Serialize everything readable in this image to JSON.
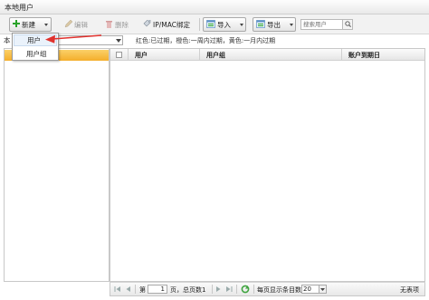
{
  "window": {
    "title": "本地用户"
  },
  "toolbar": {
    "new_label": "新建",
    "edit_label": "编辑",
    "delete_label": "删除",
    "ipmac_label": "IP/MAC绑定",
    "import_label": "导入",
    "export_label": "导出",
    "search_placeholder": "搜索用户"
  },
  "new_menu": {
    "items": [
      "用户",
      "用户组"
    ]
  },
  "filter": {
    "label_prefix": "本",
    "legend": "红色:已过期，橙色:一周内过期，黄色:一月内过期"
  },
  "grid": {
    "columns": [
      "用户",
      "用户组",
      "账户到期日"
    ],
    "rows": []
  },
  "pager": {
    "page_prefix": "第",
    "page_value": "1",
    "page_suffix": "页，总页数1",
    "page_size_label": "每页显示条目数",
    "page_size_value": "20",
    "empty_text": "无表项"
  },
  "colors": {
    "selection_orange": "#f4ae2b",
    "red_arrow": "#e0322e",
    "plus_green": "#2aa32a"
  }
}
